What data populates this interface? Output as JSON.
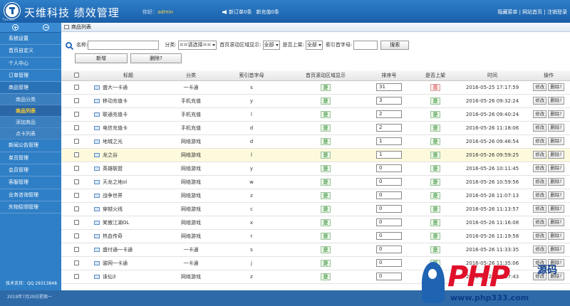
{
  "header": {
    "app_title": "天维科技 绩效管理",
    "logo_text": "TianWei",
    "welcome_label": "你好：",
    "username": "admin",
    "new_orders": "新订单0条",
    "new_recharge": "新充值0条",
    "right_links": "隐藏菜单 | 网站首页 | 注销登录"
  },
  "sidebar": {
    "items": [
      {
        "label": "系统设置"
      },
      {
        "label": "首页自定义"
      },
      {
        "label": "个人中心"
      },
      {
        "label": "订单管理"
      },
      {
        "label": "商品管理"
      }
    ],
    "sub_items": [
      {
        "label": "商品分类"
      },
      {
        "label": "商品列表"
      },
      {
        "label": "添加商品"
      },
      {
        "label": "点卡列表"
      }
    ],
    "items_after": [
      {
        "label": "新闻公告管理"
      },
      {
        "label": "单页管理"
      },
      {
        "label": "会员管理"
      },
      {
        "label": "客服管理"
      },
      {
        "label": "业务咨询管理"
      },
      {
        "label": "失物招领管理"
      }
    ],
    "support": "技术支持：QQ 29313848"
  },
  "main": {
    "panel_title": "商品列表",
    "filter": {
      "name_label": "名称:",
      "name_value": "",
      "category_label": "分类:",
      "category_value": "==请选择==",
      "home_scroll_label": "首页滚动区域显示:",
      "home_scroll_value": "全部",
      "listed_label": "是否上架:",
      "listed_value": "全部",
      "index_letter_label": "索引首字母:",
      "index_letter_value": "",
      "search_btn": "搜索"
    },
    "add_btn": "新增",
    "delete_btn": "删除?",
    "table": {
      "headers": [
        "",
        "标题",
        "分类",
        "索引首字母",
        "首页滚动区域显示",
        "排序号",
        "是否上架",
        "时间",
        "操作"
      ],
      "yes": "是",
      "no": "否",
      "edit_label": "修改",
      "delete_label": "删除?",
      "rows": [
        {
          "title": "盛大一卡通",
          "category": "一卡通",
          "letter": "s",
          "sort": "31",
          "listed": "否",
          "time": "2016-05-25 17:17:59"
        },
        {
          "title": "移动充值卡",
          "category": "手机充值",
          "letter": "y",
          "sort": "3",
          "listed": "是",
          "time": "2016-05-26 09:32:24"
        },
        {
          "title": "联通充值卡",
          "category": "手机充值",
          "letter": "l",
          "sort": "2",
          "listed": "是",
          "time": "2016-05-26 09:40:24"
        },
        {
          "title": "电信充值卡",
          "category": "手机充值",
          "letter": "d",
          "sort": "2",
          "listed": "是",
          "time": "2016-05-26 11:18:06"
        },
        {
          "title": "地城之光",
          "category": "网络游戏",
          "letter": "d",
          "sort": "1",
          "listed": "是",
          "time": "2016-05-26 09:46:54"
        },
        {
          "title": "龙之谷",
          "category": "网络游戏",
          "letter": "l",
          "sort": "1",
          "listed": "是",
          "time": "2016-05-26 09:59:25"
        },
        {
          "title": "英雄联盟",
          "category": "网络游戏",
          "letter": "y",
          "sort": "0",
          "listed": "是",
          "time": "2016-05-26 10:11:45"
        },
        {
          "title": "天龙之地ol",
          "category": "网络游戏",
          "letter": "w",
          "sort": "0",
          "listed": "是",
          "time": "2016-05-26 10:59:56"
        },
        {
          "title": "战争世界",
          "category": "网络游戏",
          "letter": "z",
          "sort": "0",
          "listed": "是",
          "time": "2016-05-26 11:07:13"
        },
        {
          "title": "穿越火线",
          "category": "网络游戏",
          "letter": "c",
          "sort": "0",
          "listed": "是",
          "time": "2016-05-26 11:13:57"
        },
        {
          "title": "笑傲江湖OL",
          "category": "网络游戏",
          "letter": "x",
          "sort": "0",
          "listed": "是",
          "time": "2016-05-26 11:16:08"
        },
        {
          "title": "热血传奇",
          "category": "网络游戏",
          "letter": "r",
          "sort": "0",
          "listed": "是",
          "time": "2016-05-26 11:19:58"
        },
        {
          "title": "盛付通一卡通",
          "category": "一卡通",
          "letter": "s",
          "sort": "0",
          "listed": "是",
          "time": "2016-05-26 11:33:35"
        },
        {
          "title": "骏网一卡通",
          "category": "一卡通",
          "letter": "j",
          "sort": "0",
          "listed": "是",
          "time": "2016-05-26 11:35:06"
        },
        {
          "title": "诛仙3",
          "category": "网络游戏",
          "letter": "z",
          "sort": "0",
          "listed": "是",
          "time": "2016-05-26 11:37:43"
        }
      ]
    }
  },
  "footer": {
    "date": "2019年7月29日星期一"
  },
  "watermark": {
    "brand": "PHP",
    "cn": "源码",
    "url": "www.php333.com"
  }
}
